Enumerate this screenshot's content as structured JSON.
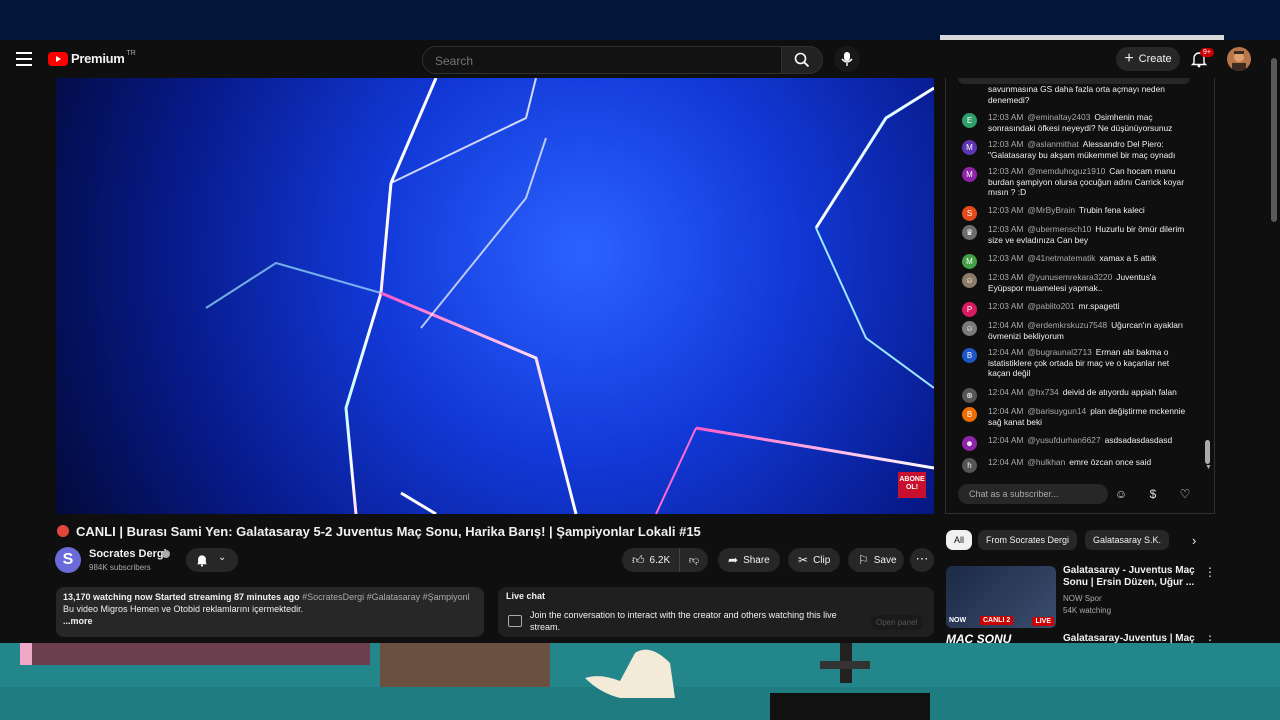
{
  "header": {
    "logo_text": "Premium",
    "region": "TR",
    "search_placeholder": "Search",
    "create_label": "Create",
    "notification_badge": "9+"
  },
  "video": {
    "watermark": "ABONE OL!"
  },
  "title": "CANLI | Burası Sami Yen: Galatasaray 5-2 Juventus Maç Sonu, Harika Barış! | Şampiyonlar Lokali #15",
  "channel": {
    "avatar_letter": "S",
    "name": "Socrates Dergi",
    "subscribers": "984K subscribers"
  },
  "actions": {
    "likes": "6.2K",
    "share": "Share",
    "clip": "Clip",
    "save": "Save"
  },
  "description": {
    "meta": "13,170 watching now  Started streaming 87 minutes ago",
    "tags": "#SocratesDergi #Galatasaray #Şampiyonl",
    "text": "Bu video Migros Hemen ve Otobid reklamlarını içermektedir.",
    "more": "...more"
  },
  "livechat_box": {
    "heading": "Live chat",
    "body": "Join the conversation to interact with the creator and others watching this live stream.",
    "open_panel": "Open panel"
  },
  "chat": {
    "messages": [
      {
        "time": "",
        "user": "",
        "text": "savunmasına GS daha fazla orta açmayı neden denemedi?",
        "avatar": "",
        "color": "#0f0f0f"
      },
      {
        "time": "12:03 AM",
        "user": "@eminaltay2403",
        "text": "Osimhenin maç sonrasındaki öfkesi neyeydi? Ne düşünüyorsunuz",
        "avatar": "E",
        "color": "#2e9e6b"
      },
      {
        "time": "12:03 AM",
        "user": "@aslanmithat",
        "text": "Alessandro Del Piero: \"Galatasaray bu akşam mükemmel bir maç oynadı",
        "avatar": "M",
        "color": "#5e35b1"
      },
      {
        "time": "12:03 AM",
        "user": "@memduhoguz1910",
        "text": "Can hocam manu burdan şampiyon olursa çocuğun adını Carrick koyar mısın ? :D",
        "avatar": "M",
        "color": "#8e24aa"
      },
      {
        "time": "12:03 AM",
        "user": "@MrByBrain",
        "text": "Trubin fena kaleci",
        "avatar": "S",
        "color": "#e64a19"
      },
      {
        "time": "12:03 AM",
        "user": "@ubermensch10",
        "text": "Huzurlu bir ömür dilerim size ve evladınıza Can bey",
        "avatar": "♛",
        "color": "#6d6d6d"
      },
      {
        "time": "12:03 AM",
        "user": "@41netmatematik",
        "text": "xamax a 5 attık",
        "avatar": "M",
        "color": "#43a047"
      },
      {
        "time": "12:03 AM",
        "user": "@yunusemrekara3220",
        "text": "Juventus'a Eyüpspor muamelesi yapmak..",
        "avatar": "☺",
        "color": "#8d7b6a"
      },
      {
        "time": "12:03 AM",
        "user": "@pablito201",
        "text": "mr.spagetti",
        "avatar": "P",
        "color": "#d81b60"
      },
      {
        "time": "12:04 AM",
        "user": "@erdemkrskuzu7548",
        "text": "Uğurcan'ın ayakları övmenizi bekliyorum",
        "avatar": "☺",
        "color": "#7a7a7a"
      },
      {
        "time": "12:04 AM",
        "user": "@bugraunal2713",
        "text": "Erman abi bakma o istatistiklere çok ortada bir maç ve o kaçanlar net kaçan değil",
        "avatar": "B",
        "color": "#1e56c8"
      },
      {
        "time": "12:04 AM",
        "user": "@hx734",
        "text": "deivid de atıyordu appiah falan",
        "avatar": "⊛",
        "color": "#555555"
      },
      {
        "time": "12:04 AM",
        "user": "@barisuygun14",
        "text": "plan değiştirme mckennie sağ kanat beki",
        "avatar": "B",
        "color": "#ef6c00"
      },
      {
        "time": "12:04 AM",
        "user": "@yusufdurhan6627",
        "text": "asdsadasdasdasd",
        "avatar": "☻",
        "color": "#8e24aa"
      },
      {
        "time": "12:04 AM",
        "user": "@hulkhan",
        "text": "emre özcan once said",
        "avatar": "h",
        "color": "#555555"
      }
    ],
    "input_placeholder": "Chat as a subscriber..."
  },
  "chips": [
    "All",
    "From Socrates Dergi",
    "Galatasaray S.K."
  ],
  "related": [
    {
      "title": "Galatasaray - Juventus Maç Sonu | Ersin Düzen, Uğur ...",
      "channel": "NOW Spor",
      "watching": "54K watching",
      "live_badge": "LIVE",
      "canli": "CANLI 2",
      "now_label": "NOW"
    },
    {
      "title": "Galatasaray-Juventus | Maç",
      "thumb_text": "MAÇ SONU"
    }
  ]
}
